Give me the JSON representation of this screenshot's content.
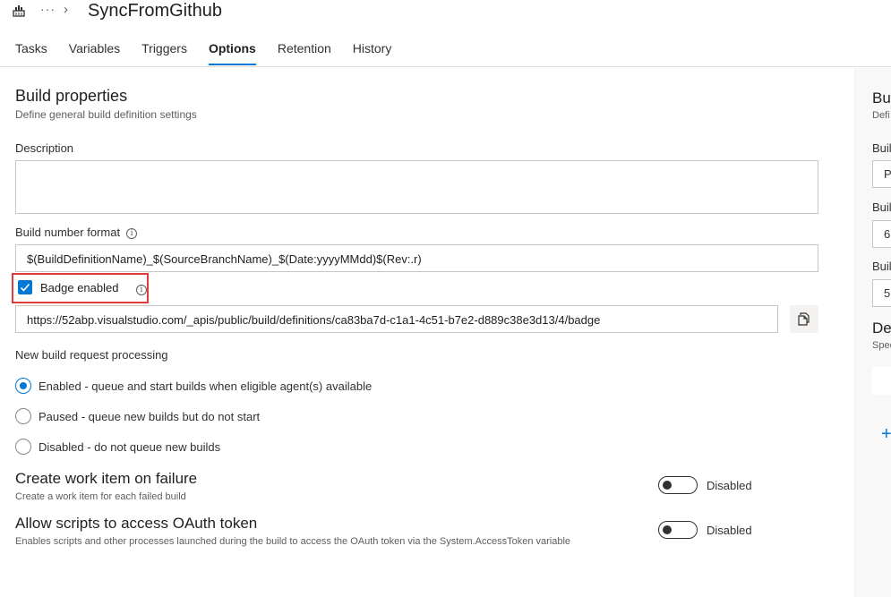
{
  "header": {
    "title": "SyncFromGithub",
    "more_glyph": "···",
    "chevron_glyph": "›",
    "tabs": [
      {
        "label": "Tasks",
        "active": false
      },
      {
        "label": "Variables",
        "active": false
      },
      {
        "label": "Triggers",
        "active": false
      },
      {
        "label": "Options",
        "active": true
      },
      {
        "label": "Retention",
        "active": false
      },
      {
        "label": "History",
        "active": false
      }
    ]
  },
  "build_properties": {
    "title": "Build properties",
    "subtitle": "Define general build definition settings",
    "description_label": "Description",
    "description_value": "",
    "build_number_label": "Build number format",
    "build_number_value": "$(BuildDefinitionName)_$(SourceBranchName)_$(Date:yyyyMMdd)$(Rev:.r)",
    "badge_label": "Badge enabled",
    "badge_enabled": true,
    "badge_url": "https://52abp.visualstudio.com/_apis/public/build/definitions/ca83ba7d-c1a1-4c51-b7e2-d889c38e3d13/4/badge"
  },
  "request_processing": {
    "label": "New build request processing",
    "options": [
      {
        "label": "Enabled - queue and start builds when eligible agent(s) available",
        "selected": true
      },
      {
        "label": "Paused - queue new builds but do not start",
        "selected": false
      },
      {
        "label": "Disabled - do not queue new builds",
        "selected": false
      }
    ]
  },
  "work_item": {
    "title": "Create work item on failure",
    "desc": "Create a work item for each failed build",
    "status": "Disabled"
  },
  "oauth": {
    "title": "Allow scripts to access OAuth token",
    "desc": "Enables scripts and other processes launched during the build to access the OAuth token via the System.AccessToken variable",
    "status": "Disabled"
  },
  "right_panel": {
    "title": "Bu",
    "subtitle": "Defi",
    "label1": "Buil",
    "value1": "P",
    "label2": "Buil",
    "value2": "6",
    "label3": "Buil",
    "value3": "5",
    "title2": "De",
    "subtitle2": "Spec",
    "plus_glyph": "+"
  },
  "colors": {
    "accent": "#0078d4",
    "highlight": "#e03a3a"
  }
}
